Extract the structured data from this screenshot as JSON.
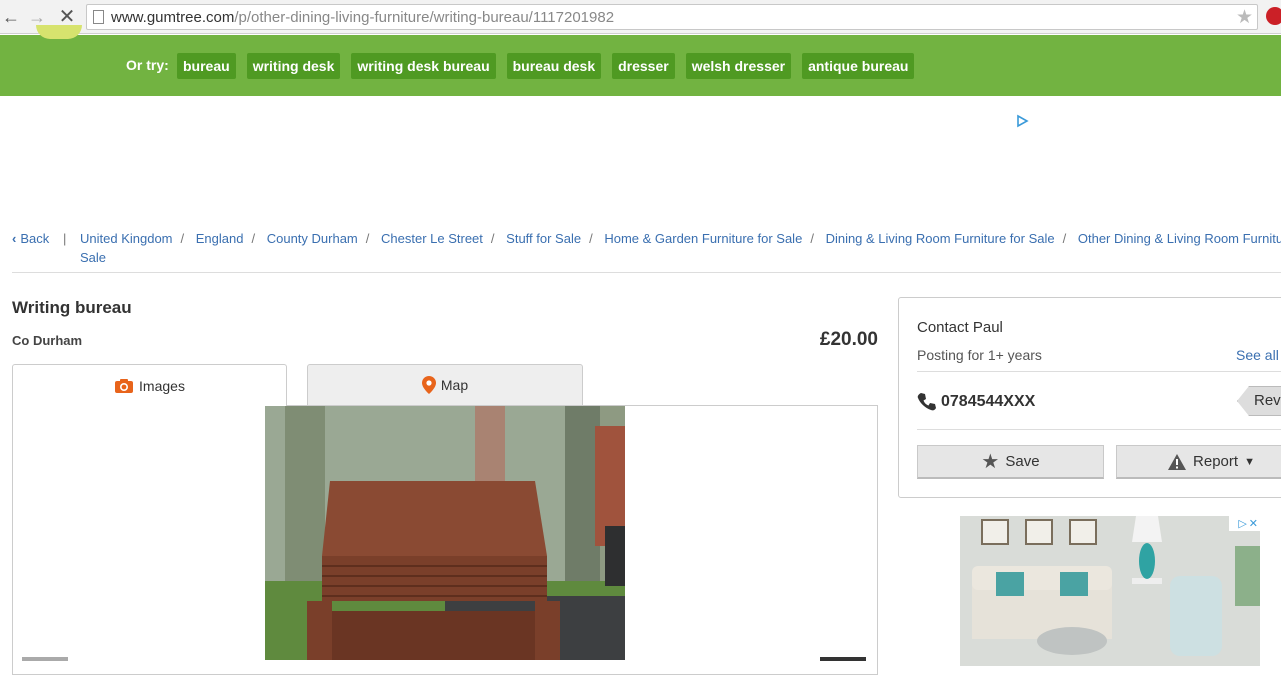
{
  "browser": {
    "url_host": "www.gumtree.com",
    "url_path": "/p/other-dining-living-furniture/writing-bureau/1117201982"
  },
  "header": {
    "or_try_label": "Or try:",
    "suggestions": [
      "bureau",
      "writing desk",
      "writing desk bureau",
      "bureau desk",
      "dresser",
      "welsh dresser",
      "antique bureau"
    ]
  },
  "breadcrumb": {
    "back_label": "Back",
    "items": [
      "United Kingdom",
      "England",
      "County Durham",
      "Chester Le Street",
      "Stuff for Sale",
      "Home & Garden Furniture for Sale",
      "Dining & Living Room Furniture for Sale",
      "Other Dining & Living Room Furnitu"
    ],
    "wrap_text": "Sale"
  },
  "listing": {
    "title": "Writing bureau",
    "location": "Co Durham",
    "price": "£20.00"
  },
  "tabs": {
    "images_label": "Images",
    "map_label": "Map"
  },
  "contact": {
    "name": "Contact Paul",
    "posting_for": "Posting for 1+ years",
    "see_all": "See all",
    "phone": "0784544XXX",
    "reveal_label": "Reve",
    "save_label": "Save",
    "report_label": "Report"
  },
  "colors": {
    "brand_green": "#72b341",
    "chip_green": "#4f9a22",
    "link_blue": "#3a6fb0",
    "map_pin": "#e8641b",
    "camera": "#e8641b"
  }
}
